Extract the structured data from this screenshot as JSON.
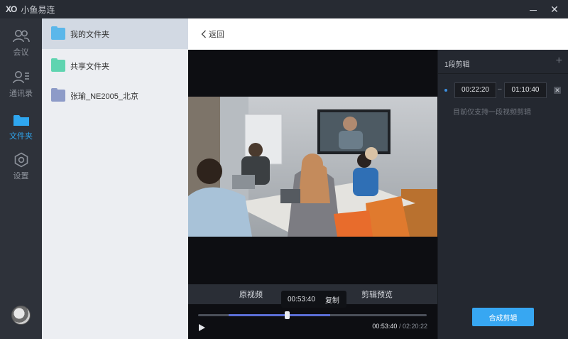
{
  "titlebar": {
    "logo": "XO",
    "app_name": "小鱼易连",
    "minimize_label": "",
    "close_label": "✕"
  },
  "nav": [
    {
      "label": "会议",
      "icon": "meeting-people-icon"
    },
    {
      "label": "通讯录",
      "icon": "contacts-icon"
    },
    {
      "label": "文件夹",
      "icon": "folder-icon",
      "active": true
    },
    {
      "label": "设置",
      "icon": "gear-icon"
    }
  ],
  "folders": [
    {
      "name": "我的文件夹",
      "color": "#5bb7ea",
      "selected": true
    },
    {
      "name": "共享文件夹",
      "color": "#5fd4b0"
    },
    {
      "name": "张瑜_NE2005_北京",
      "color": "#8d9bc8"
    }
  ],
  "topbar": {
    "back_label": "返回"
  },
  "player": {
    "tab_original": "原视频",
    "tab_clip_preview": "剪辑预览",
    "bubble_time": "00:53:40",
    "bubble_copy": "复制",
    "current_time": "00:53:40",
    "total_time": "/ 02:20:22",
    "progress_fraction": 0.38
  },
  "clips": {
    "header": "1段剪辑",
    "add_label": "+",
    "start": "00:22:20",
    "separator": "–",
    "end": "01:10:40",
    "delete_label": "✕",
    "note": "目前仅支持一段视频剪辑",
    "merge_button": "合成剪辑"
  },
  "colors": {
    "accent": "#37a7f2",
    "active_nav": "#2fa7f0",
    "range": "#5b6fd6"
  }
}
